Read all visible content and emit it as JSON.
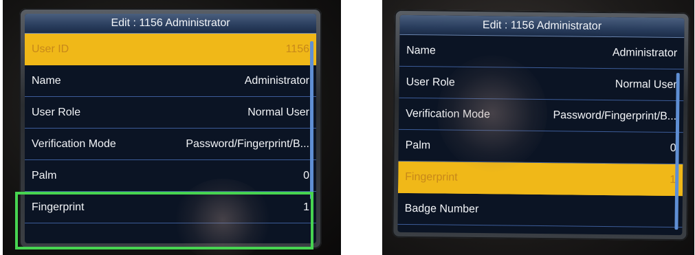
{
  "left_device": {
    "title": "Edit : 1156 Administrator",
    "rows": [
      {
        "label": "User ID",
        "value": "1156",
        "selected": true
      },
      {
        "label": "Name",
        "value": "Administrator",
        "selected": false
      },
      {
        "label": "User Role",
        "value": "Normal User",
        "selected": false
      },
      {
        "label": "Verification Mode",
        "value": "Password/Fingerprint/B...",
        "selected": false
      },
      {
        "label": "Palm",
        "value": "0",
        "selected": false
      },
      {
        "label": "Fingerprint",
        "value": "1",
        "selected": false
      }
    ]
  },
  "right_device": {
    "title": "Edit : 1156 Administrator",
    "rows": [
      {
        "label": "Name",
        "value": "Administrator",
        "selected": false
      },
      {
        "label": "User Role",
        "value": "Normal User",
        "selected": false
      },
      {
        "label": "Verification Mode",
        "value": "Password/Fingerprint/B...",
        "selected": false
      },
      {
        "label": "Palm",
        "value": "0",
        "selected": false
      },
      {
        "label": "Fingerprint",
        "value": "1",
        "selected": true
      },
      {
        "label": "Badge Number",
        "value": "",
        "selected": false
      }
    ]
  },
  "colors": {
    "selected_row": "#f0b818",
    "highlight_box": "#47d451",
    "screen_bg": "#0b1424",
    "divider": "#3d5d9a"
  }
}
